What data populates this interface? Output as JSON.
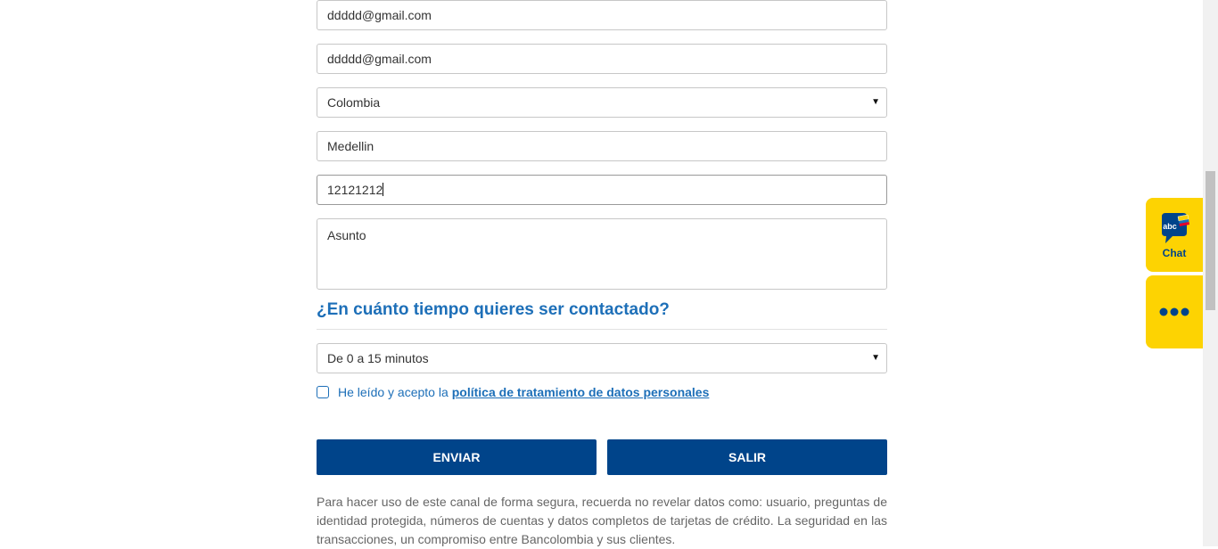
{
  "form": {
    "email": "ddddd@gmail.com",
    "email_confirm": "ddddd@gmail.com",
    "country": "Colombia",
    "city": "Medellin",
    "phone": "12121212",
    "subject_placeholder": "Asunto"
  },
  "contact_time": {
    "heading": "¿En cuánto tiempo quieres ser contactado?",
    "selected": "De 0 a 15 minutos"
  },
  "consent": {
    "text": "He leído y acepto la",
    "link": "política de tratamiento de datos personales"
  },
  "buttons": {
    "send": "ENVIAR",
    "exit": "SALIR"
  },
  "disclaimer": "Para hacer uso de este canal de forma segura, recuerda no revelar datos como: usuario, preguntas de identidad protegida, números de cuentas y datos completos de tarjetas de crédito. La seguridad en las transacciones, un compromiso entre Bancolombia y sus clientes.",
  "side_widgets": {
    "chat_label": "Chat",
    "chat_icon_text": "abc",
    "more_icon": "more-dots-icon"
  },
  "colors": {
    "primary_blue": "#00448a",
    "link_blue": "#1d6fb8",
    "yellow": "#fdd302"
  }
}
